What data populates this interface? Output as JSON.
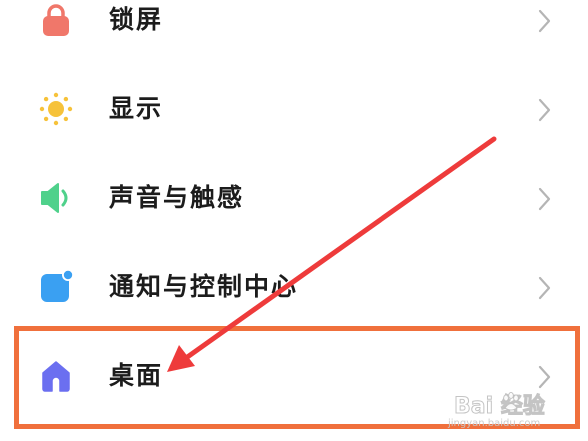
{
  "settings": {
    "items": [
      {
        "label": "锁屏",
        "icon": "lock-icon",
        "icon_color": "#f0776a"
      },
      {
        "label": "显示",
        "icon": "sun-icon",
        "icon_color": "#f6c23a"
      },
      {
        "label": "声音与触感",
        "icon": "speaker-icon",
        "icon_color": "#4fd18b"
      },
      {
        "label": "通知与控制中心",
        "icon": "notification-icon",
        "icon_color": "#3aa0f2"
      },
      {
        "label": "桌面",
        "icon": "home-icon",
        "icon_color": "#6b6ff0"
      }
    ]
  },
  "annotation": {
    "highlight_color": "#f0703c",
    "arrow_color": "#ee3b3b"
  },
  "watermark": {
    "brand": "Bai  经验",
    "url": "jingyan.baidu.com"
  }
}
